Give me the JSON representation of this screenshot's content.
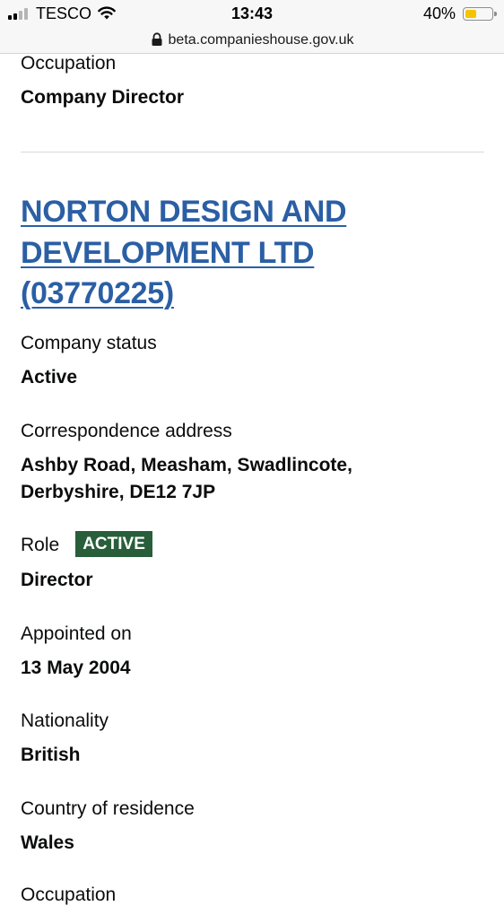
{
  "status_bar": {
    "carrier": "TESCO",
    "time": "13:43",
    "battery": "40%",
    "battery_level": 0.4,
    "icons": [
      "signal-icon",
      "wifi-icon",
      "battery-icon"
    ]
  },
  "browser": {
    "url": "beta.companieshouse.gov.uk",
    "icon": "lock-icon"
  },
  "top_section": {
    "label": "Occupation",
    "value": "Company Director"
  },
  "appointment": {
    "company_link": "NORTON DESIGN AND DEVELOPMENT LTD (03770225)",
    "company_status_label": "Company status",
    "company_status": "Active",
    "address_label": "Correspondence address",
    "address": "Ashby Road, Measham, Swadlincote, Derbyshire, DE12 7JP",
    "role_label": "Role",
    "role_tag": "ACTIVE",
    "role": "Director",
    "appointed_label": "Appointed on",
    "appointed": "13 May 2004",
    "nationality_label": "Nationality",
    "nationality": "British",
    "residence_label": "Country of residence",
    "residence": "Wales",
    "occupation_label": "Occupation"
  },
  "colors": {
    "link": "#2b5fa4",
    "tag_background": "#285e3a",
    "text": "#0b0c0c"
  }
}
